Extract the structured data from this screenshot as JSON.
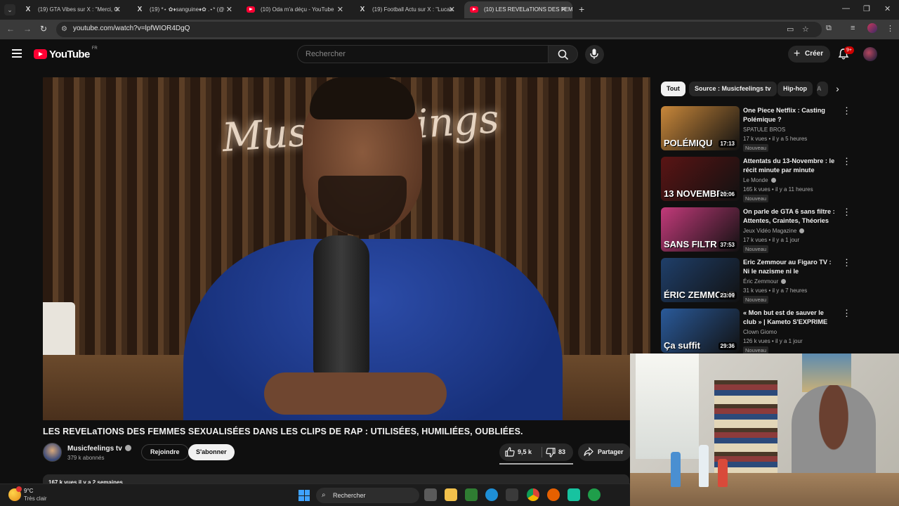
{
  "browser": {
    "tabs": [
      {
        "title": "(19) GTA Vibes sur X : \"Merci, G",
        "favicon": "x-logo",
        "active": false
      },
      {
        "title": "(19) *⋆ ✿♦sanguine♦✿ .⋆* (@",
        "favicon": "x-logo",
        "active": false
      },
      {
        "title": "(10) Oda m'a déçu - YouTube",
        "favicon": "youtube-logo",
        "active": false
      },
      {
        "title": "(19) Football Actu sur X : \"Lucas",
        "favicon": "x-logo",
        "active": false
      },
      {
        "title": "(10) LES REVELaTIONS DES FEM",
        "favicon": "youtube-logo",
        "active": true
      }
    ],
    "url": "youtube.com/watch?v=lpfWIOR4DgQ"
  },
  "masthead": {
    "logo_text": "YouTube",
    "country_code": "FR",
    "search_placeholder": "Rechercher",
    "create_label": "Créer",
    "notification_count": "9+"
  },
  "player": {
    "neon_sign": "Musicfeelings"
  },
  "video": {
    "title": "LES REVELaTIONS DES FEMMES SEXUALISÉES DANS LES CLIPS DE RAP : UTILISÉES, HUMILIÉES, OUBLIÉES.",
    "channel_name": "Musicfeelings tv",
    "subscribers": "379 k abonnés",
    "join_label": "Rejoindre",
    "subscribe_label": "S'abonner",
    "likes": "9,5 k",
    "dislikes": "83",
    "share_label": "Partager",
    "description_meta": "167 k vues  il y a 2 semaines"
  },
  "chips": [
    "Tout",
    "Source : Musicfeelings tv",
    "Hip-hop"
  ],
  "recommendations": [
    {
      "title": "One Piece Netflix : Casting Polémique ?",
      "channel": "SPATULE BROS",
      "verified": false,
      "stats": "17 k vues • il y a 5 heures",
      "badge": "Nouveau",
      "duration": "17:13",
      "thumb_text": "POLÉMIQU",
      "thumb_color": "#c8873a"
    },
    {
      "title": "Attentats du 13-Novembre : le récit minute par minute (Stade...",
      "channel": "Le Monde",
      "verified": true,
      "stats": "165 k vues • il y a 11 heures",
      "badge": "Nouveau",
      "duration": "20:06",
      "thumb_text": "13 NOVEMBRE",
      "thumb_color": "#5a1414"
    },
    {
      "title": "On parle de GTA 6 sans filtre : Attentes, Craintes, Théories et...",
      "channel": "Jeux Vidéo Magazine",
      "verified": true,
      "stats": "17 k vues • il y a 1 jour",
      "badge": "Nouveau",
      "duration": "37:53",
      "thumb_text": "SANS FILTR",
      "thumb_color": "#c23a7a"
    },
    {
      "title": "Eric Zemmour au Figaro TV : Ni le nazisme ni le communisme ...",
      "channel": "Éric Zemmour",
      "verified": true,
      "stats": "31 k vues • il y a 7 heures",
      "badge": "Nouveau",
      "duration": "23:09",
      "thumb_text": "ÉRIC ZEMMOUR",
      "thumb_color": "#1f3f6a"
    },
    {
      "title": "« Mon but est de sauver le club » | Kameto S'EXPRIME sur ...",
      "channel": "Clown Giomo",
      "verified": false,
      "stats": "126 k vues • il y a 1 jour",
      "badge": "Nouveau",
      "duration": "29:36",
      "thumb_text": "Ça suffit",
      "thumb_color": "#2a5a9a"
    }
  ],
  "taskbar": {
    "temperature": "9°C",
    "condition": "Très clair",
    "search_label": "Rechercher"
  },
  "colors": {
    "youtube_red": "#ff0033",
    "background": "#0f0f0f",
    "chip_bg": "#272727"
  }
}
